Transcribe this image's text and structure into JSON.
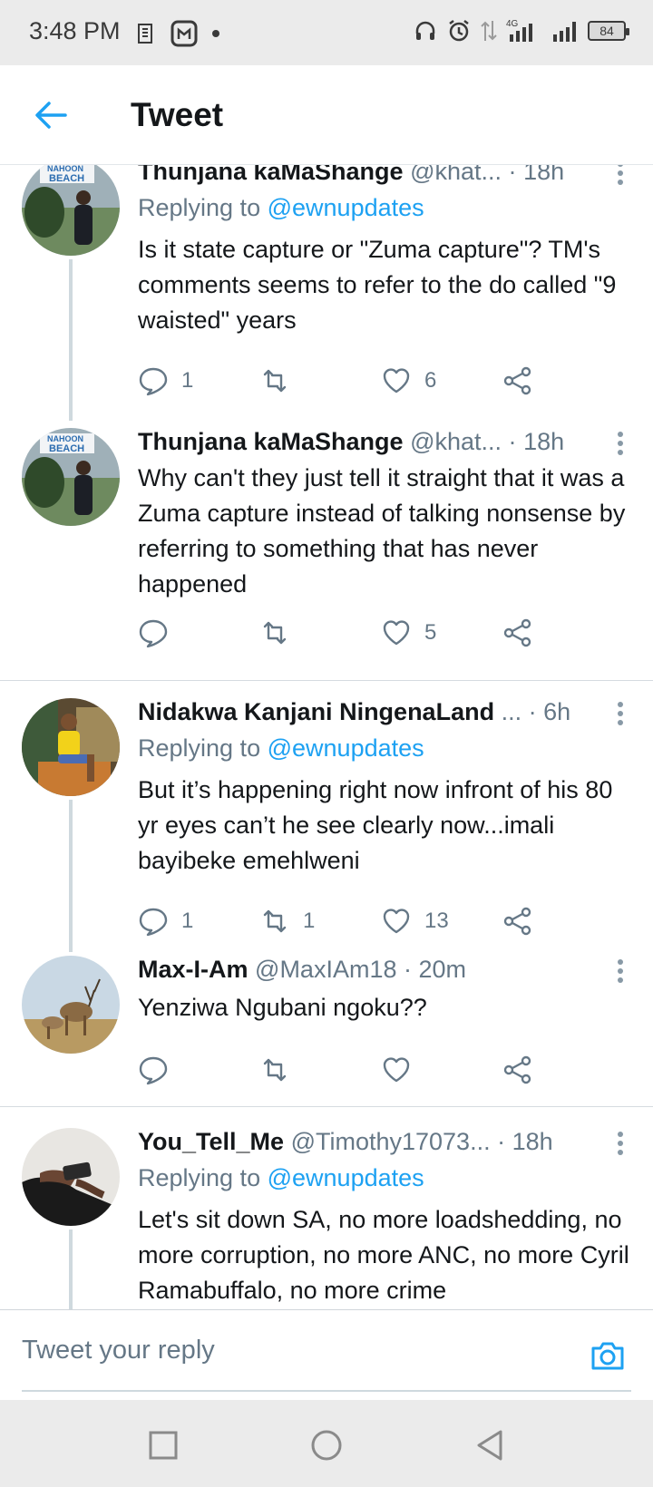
{
  "status_bar": {
    "time": "3:48 PM",
    "network": "4G",
    "battery": "84"
  },
  "header": {
    "title": "Tweet",
    "back_icon": "arrow-left-icon"
  },
  "colors": {
    "accent": "#1da1f2",
    "text": "#14171a",
    "muted": "#657786",
    "thread_line": "#cfd9de"
  },
  "tweets": [
    {
      "name": "Thunjana kaMaShange",
      "handle": "@khat...",
      "time": "18h",
      "replying_prefix": "Replying to",
      "replying_to": "@ewnupdates",
      "text": "Is it state capture or \"Zuma capture\"? TM's comments seems to refer to the do called \"9 waisted\" years",
      "replies": "1",
      "retweets": "",
      "likes": "6"
    },
    {
      "name": "Thunjana kaMaShange",
      "handle": "@khat...",
      "time": "18h",
      "text": "Why can't they just tell it straight that it was a Zuma capture instead of talking nonsense by referring to something that has never happened",
      "replies": "",
      "retweets": "",
      "likes": "5"
    },
    {
      "name": "Nidakwa Kanjani NingenaLand",
      "handle": "...",
      "time": "6h",
      "replying_prefix": "Replying to",
      "replying_to": "@ewnupdates",
      "text": "But it’s happening right now infront of his 80 yr eyes can’t he see clearly now...imali bayibeke emehlweni",
      "replies": "1",
      "retweets": "1",
      "likes": "13"
    },
    {
      "name": "Max-I-Am",
      "handle": "@MaxIAm18",
      "time": "20m",
      "text": "Yenziwa Ngubani ngoku??",
      "replies": "",
      "retweets": "",
      "likes": ""
    },
    {
      "name": "You_Tell_Me",
      "handle": "@Timothy17073...",
      "time": "18h",
      "replying_prefix": "Replying to",
      "replying_to": "@ewnupdates",
      "text": "Let's sit down SA, no more loadshedding, no more corruption, no more ANC, no more Cyril Ramabuffalo, no more crime"
    }
  ],
  "reply_bar": {
    "placeholder": "Tweet your reply",
    "camera_icon": "camera-icon"
  },
  "nav_bar": {
    "recents_icon": "square-icon",
    "home_icon": "circle-icon",
    "back_icon": "triangle-back-icon"
  }
}
